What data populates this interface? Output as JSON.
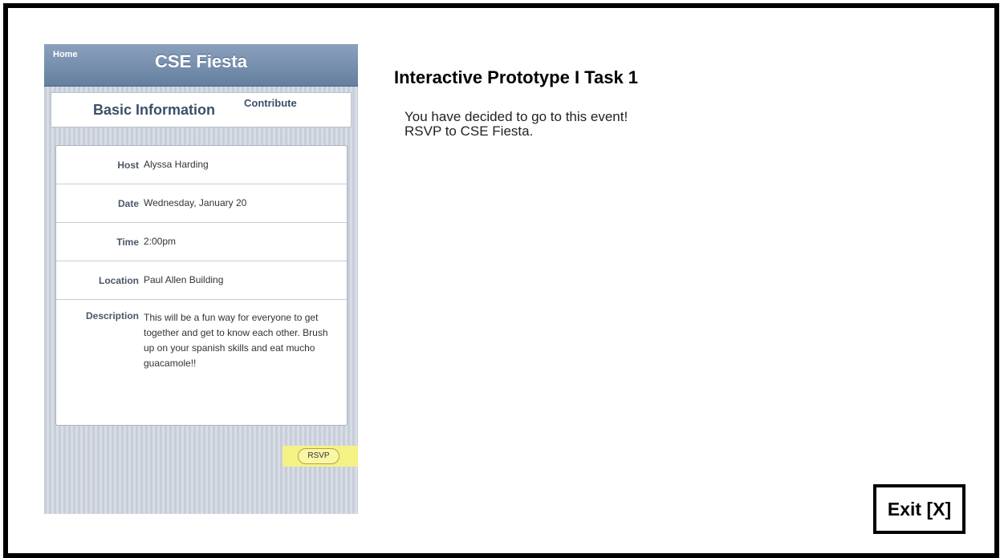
{
  "phone": {
    "nav": {
      "home_label": "Home",
      "title": "CSE Fiesta"
    },
    "tabs": {
      "basic_label": "Basic Information",
      "contribute_label": "Contribute"
    },
    "rows": [
      {
        "label": "Host",
        "value": "Alyssa Harding"
      },
      {
        "label": "Date",
        "value": "Wednesday, January 20"
      },
      {
        "label": "Time",
        "value": "2:00pm"
      },
      {
        "label": "Location",
        "value": "Paul Allen Building"
      },
      {
        "label": "Description",
        "value": "This will be a fun way for everyone to get together and get to know each other. Brush up on your spanish skills and eat mucho guacamole!!"
      }
    ],
    "rsvp_label": "RSVP",
    "highlight_color": "#f5f285"
  },
  "task": {
    "title": "Interactive Prototype I Task 1",
    "line1": "You have decided to go to this event!",
    "line2": "RSVP to CSE Fiesta."
  },
  "exit_label": "Exit [X]"
}
